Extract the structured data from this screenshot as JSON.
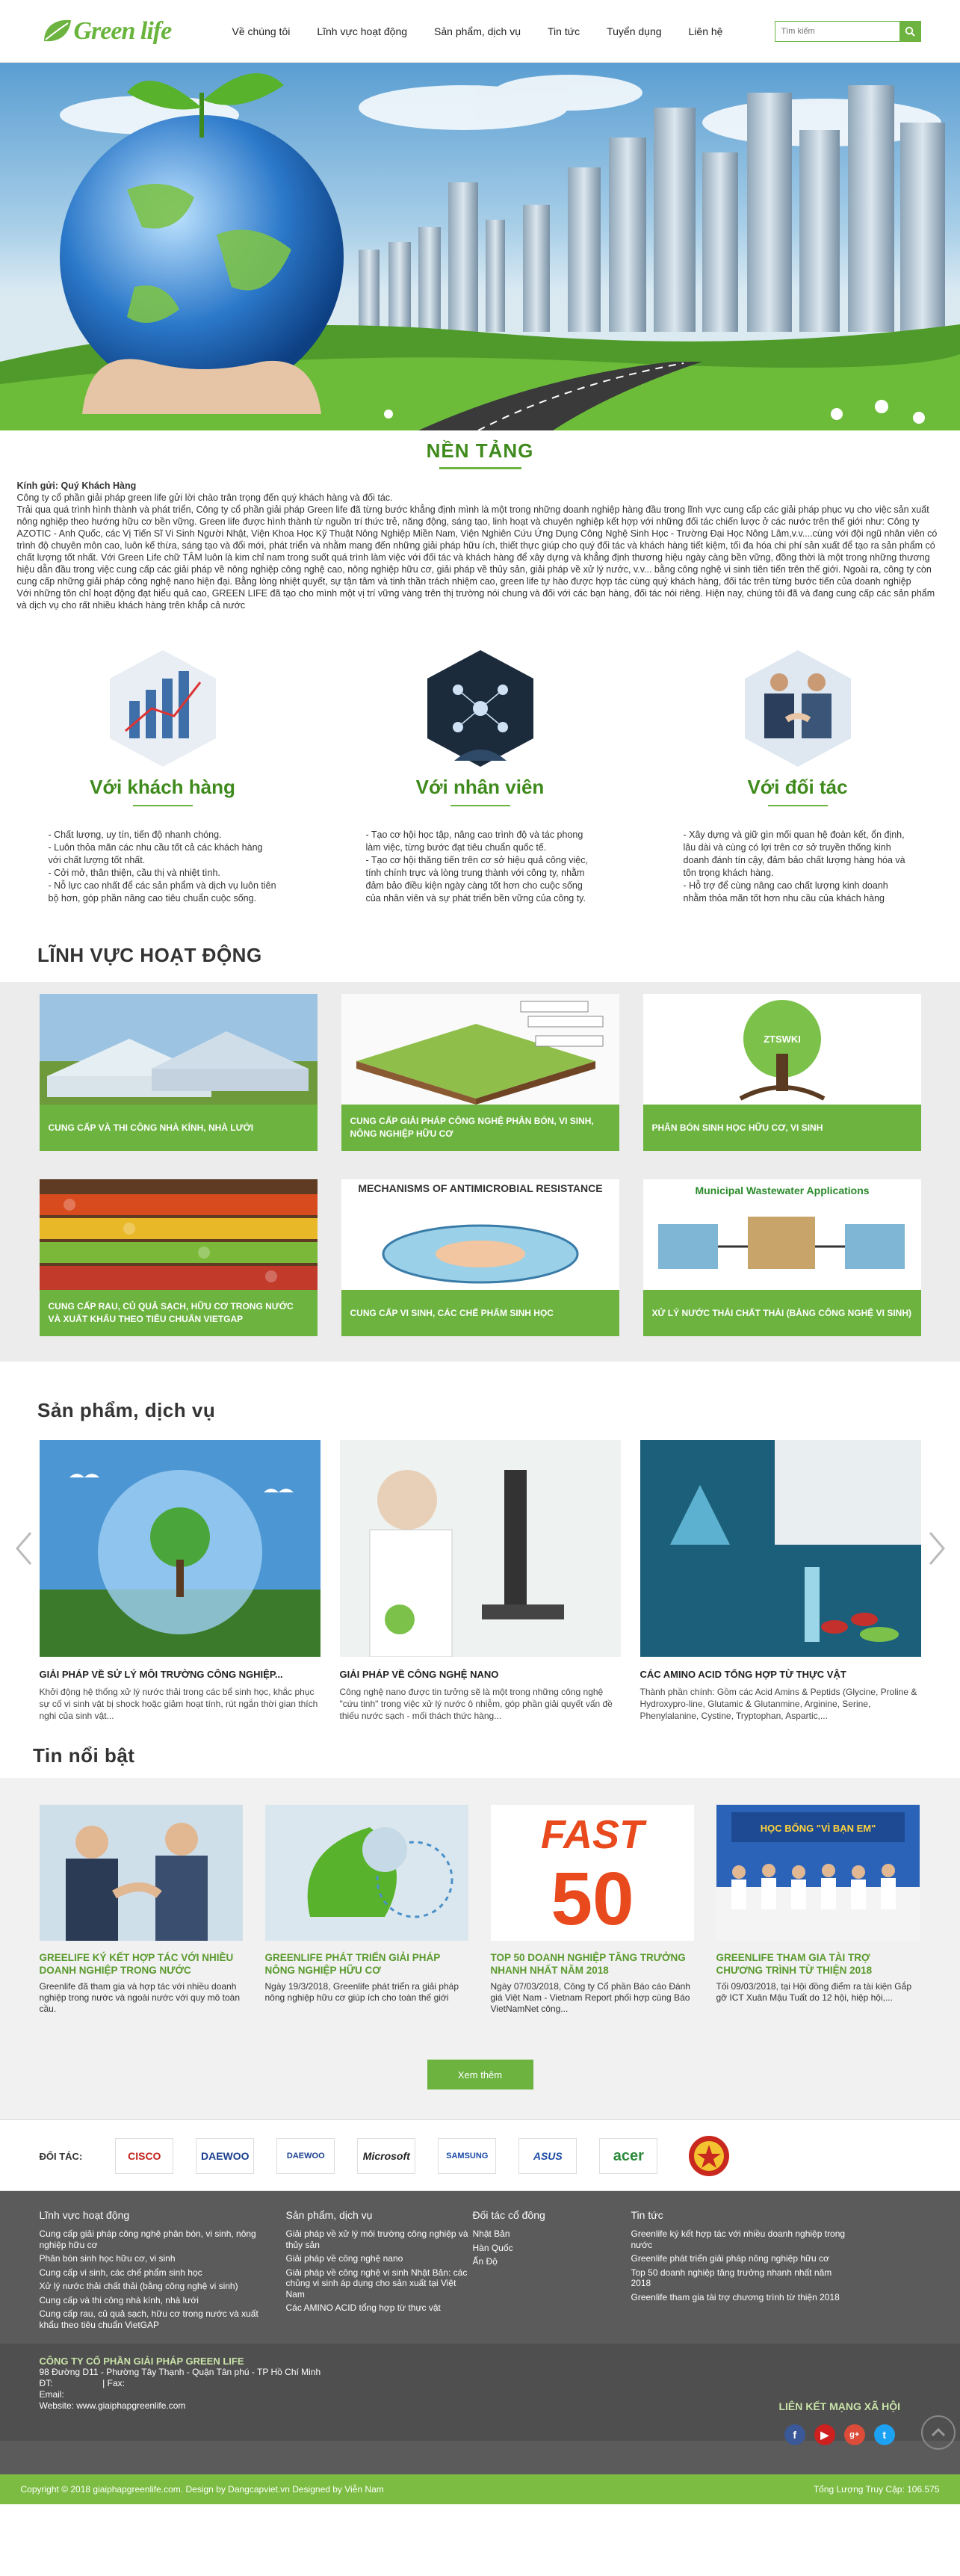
{
  "header": {
    "logo": "Green life",
    "nav": [
      "Về chúng tôi",
      "Lĩnh vực hoạt động",
      "Sản phẩm, dịch vụ",
      "Tin tức",
      "Tuyển dụng",
      "Liên hệ"
    ],
    "search_placeholder": "Tìm kiếm"
  },
  "nen_tang": {
    "title": "NỀN TẢNG",
    "greeting": "Kính gửi: Quý Khách Hàng",
    "p1": "Công ty cổ phần giải pháp green life gửi lời chào trân trọng đến quý khách hàng và đối tác.",
    "p2": "Trải qua quá trình hình thành và phát triển, Công ty cổ phần giải pháp Green life đã từng bước khẳng định mình là một trong những doanh nghiệp hàng đầu trong lĩnh vực cung cấp các giải pháp phục vụ cho việc sản xuất nông nghiệp theo hướng hữu cơ bền vững. Green life được hình thành từ nguồn trí thức trẻ, năng động, sáng tạo, linh hoạt và chuyên nghiệp kết hợp với những đối tác chiến lược ở các nước trên thế giới như: Công ty AZOTIC - Anh Quốc, các Vị Tiến Sĩ Vi Sinh Người Nhật, Viện Khoa Học Kỹ Thuật Nông Nghiệp Miền Nam, Viện Nghiên Cứu Ứng Dụng Công Nghệ Sinh Học - Trường Đại Học Nông Lâm,v.v....cùng với đội ngũ nhân viên có trình độ chuyên môn cao, luôn kế thừa, sáng tạo và đổi mới, phát triển và nhằm mang đến những giải pháp hữu ích, thiết thực giúp cho quý đối tác và khách hàng tiết kiệm, tối đa hóa chi phí sản xuất để tạo ra sản phẩm có chất lượng tốt nhất. Với Green Life chữ TÂM luôn là kim chỉ nam trong suốt quá trình làm việc với đối tác và khách hàng để xây dựng và khẳng định thương hiệu ngày càng bền vững, đồng thời là một trong những thương hiệu dẫn đầu trong việc cung cấp các giải pháp về nông nghiệp công nghệ cao, nông nghiệp hữu cơ, giải pháp về thủy sản, giải pháp về xử lý nước, v.v... bằng công nghệ vi sinh tiên tiến trên thế giới. Ngoài ra, công ty còn cung cấp những giải pháp công nghệ nano hiện đại. Bằng lòng nhiệt quyết, sự tận tâm và tinh thần trách nhiệm cao, green life tự hào được hợp tác cùng quý khách hàng, đối tác trên từng bước tiến của doanh nghiệp",
    "p3": "Với những tôn chỉ hoạt động đạt hiểu quả cao, GREEN LIFE đã tạo cho mình một vị trí vững vàng trên thị trường nói chung và đối với các bạn hàng, đối tác nói riêng. Hiện nay, chúng tôi đã và đang cung cấp các sản phẩm và dịch vụ cho rất nhiều khách hàng trên khắp cả nước"
  },
  "values": [
    {
      "title": "Với khách hàng",
      "lines": [
        "- Chất lượng, uy tín, tiến độ nhanh chóng.",
        "- Luôn thỏa mãn các nhu cầu tốt cả các khách hàng với chất lượng tốt nhất.",
        "- Cởi mở, thân thiện, cầu thị và nhiệt tình.",
        "- Nỗ lực cao nhất để các sản phẩm và dịch vụ luôn tiên bộ hơn, góp phần nâng cao tiêu chuẩn cuộc sống."
      ]
    },
    {
      "title": "Với nhân viên",
      "lines": [
        "- Tạo cơ hội học tập, nâng cao trình độ và tác phong làm việc, từng bước đạt tiêu chuẩn quốc tế.",
        "- Tạo cơ hội thăng tiến trên cơ sở hiệu quả công việc, tính chính trực và lòng trung thành với công ty, nhằm đảm bảo điều kiện ngày càng tốt hơn cho cuộc sống của nhân viên và sự phát triển bền vững của công ty."
      ]
    },
    {
      "title": "Với đối tác",
      "lines": [
        "- Xây dựng và giữ gìn mối quan hệ đoàn kết, ổn định, lâu dài và cùng có lợi trên cơ sở truyền thống kinh doanh đánh tín cậy, đảm bảo chất lượng hàng hóa và tôn trọng khách hàng.",
        "- Hỗ trợ để cùng nâng cao chất lượng kinh doanh nhằm thỏa mãn tốt hơn nhu cầu của khách hàng"
      ]
    }
  ],
  "linh_vuc": {
    "title": "LĨNH VỰC HOẠT ĐỘNG",
    "cards": [
      "CUNG CẤP VÀ THI CÔNG NHÀ KÍNH, NHÀ LƯỚI",
      "CUNG CẤP GIẢI PHÁP CÔNG NGHỆ PHÂN BÓN, VI SINH, NÔNG NGHIỆP HỮU CƠ",
      "PHÂN BÓN SINH HỌC HỮU CƠ, VI SINH",
      "CUNG CẤP RAU, CỦ QUẢ SẠCH, HỮU CƠ TRONG NƯỚC VÀ XUẤT KHẨU THEO TIÊU CHUẨN VIETGAP",
      "CUNG CẤP VI SINH, CÁC CHẾ PHẨM SINH HỌC",
      "XỬ LÝ NƯỚC THẢI CHẤT THẢI (BẰNG CÔNG NGHỆ VI SINH)"
    ],
    "img_texts": {
      "ztswki": "ZTSWKI",
      "mechanisms": "MECHANISMS OF ANTIMICROBIAL RESISTANCE",
      "wastewater": "Municipal Wastewater Applications"
    }
  },
  "san_pham": {
    "title": "Sản phẩm, dịch vụ",
    "items": [
      {
        "title": "GIẢI PHÁP VỀ SỬ LÝ MÔI TRƯỜNG CÔNG NGHIỆP...",
        "desc": "Khởi động hệ thống xử lý nước thải trong các bể sinh học, khắc phục sự cố vi sinh vật bị shock hoặc giảm hoạt tính, rút ngắn thời gian thích nghi của sinh vật..."
      },
      {
        "title": "GIẢI PHÁP VỀ CÔNG NGHỆ NANO",
        "desc": "Công nghệ nano được tin tưởng sẽ là một trong những công nghệ \"cứu tinh\" trong việc xử lý nước ô nhiễm, góp phần giải quyết vấn đề thiếu nước sạch - mối thách thức hàng..."
      },
      {
        "title": "CÁC AMINO ACID TỔNG HỢP TỪ THỰC VẬT",
        "desc": "Thành phần chính: Gồm các Acid Amins & Peptids (Glycine, Proline & Hydroxypro-line, Glutamic & Glutanmine, Arginine, Serine, Phenylalanine, Cystine, Tryptophan, Aspartic,..."
      }
    ]
  },
  "tin": {
    "title": "Tin nổi bật",
    "items": [
      {
        "title": "GREELIFE KÝ KẾT HỢP TÁC VỚI NHIỀU DOANH NGHIỆP TRONG NƯỚC",
        "desc": "Greenlife đã tham gia và hợp tác với nhiều doanh nghiệp trong nước và ngoài nước với quy mô toàn cầu."
      },
      {
        "title": "GREENLIFE PHÁT TRIỂN GIẢI PHÁP NÔNG NGHIỆP HỮU CƠ",
        "desc": "Ngày 19/3/2018, Greenlife phát triển ra giải pháp nông nghiệp hữu cơ giúp ích cho toàn thế giới"
      },
      {
        "title": "TOP 50 DOANH NGHIỆP TĂNG TRƯỞNG NHANH NHẤT NĂM 2018",
        "desc": "Ngày 07/03/2018, Công ty Cổ phần Báo cáo Đánh giá Việt Nam - Vietnam Report phối hợp cùng Báo VietNamNet công..."
      },
      {
        "title": "GREENLIFE THAM GIA TÀI TRỢ CHƯƠNG TRÌNH TỪ THIỆN 2018",
        "desc": "Tối 09/03/2018, tại Hội đồng điểm ra tài kiện Gắp gỡ ICT Xuân Mậu Tuất do 12 hội, hiệp hội,..."
      }
    ],
    "img_texts": {
      "fast": "FAST",
      "fifty": "50",
      "banner": "HỌC BỔNG \"VÌ BẠN EM\""
    },
    "more": "Xem thêm"
  },
  "partners": {
    "label": "ĐỐI TÁC:",
    "logos": [
      "CISCO",
      "DAEWOO",
      "DAEWOO",
      "Microsoft",
      "SAMSUNG",
      "ASUS",
      "acer",
      ""
    ]
  },
  "footer": {
    "cols": [
      {
        "title": "Lĩnh vực hoạt động",
        "items": [
          "Cung cấp giải pháp công nghệ phân bón, vi sinh, nông nghiệp hữu cơ",
          "Phân bón sinh học hữu cơ, vi sinh",
          "Cung cấp vi sinh, các chế phẩm sinh học",
          "Xử lý nước thải chất thải (bằng công nghệ vi sinh)",
          "Cung cấp và thi công nhà kính, nhà lưới",
          "Cung cấp rau, củ quả sạch, hữu cơ trong nước và xuất khẩu theo tiêu chuẩn VietGAP"
        ]
      },
      {
        "title": "Sản phẩm, dịch vụ",
        "items": [
          "Giải pháp về xử lý môi trường công nghiệp và thủy sản",
          "Giải pháp về công nghệ nano",
          "Giải pháp về công nghệ vi sinh Nhật Bản: các chủng vi sinh áp dụng cho sản xuất tại Việt Nam",
          "Các AMINO ACID tổng hợp từ thực vật"
        ]
      },
      {
        "title": "Đối tác cổ đông",
        "items": [
          "Nhật Bản",
          "Hàn Quốc",
          "Ấn Độ"
        ]
      },
      {
        "title": "Tin tức",
        "items": [
          "Greenlife ký kết hợp tác với nhiều doanh nghiệp trong nước",
          "Greenlife phát triển giải pháp nông nghiệp hữu cơ",
          "Top 50 doanh nghiệp tăng trưởng nhanh nhất năm 2018",
          "Greenlife tham gia tài trợ chương trình từ thiện 2018"
        ]
      }
    ],
    "company": "CÔNG TY CỔ PHẦN GIẢI PHÁP GREEN LIFE",
    "address": "98 Đường D11 - Phường Tây Thạnh - Quận Tân phú - TP Hồ Chí Minh",
    "phone": "ĐT:                    | Fax:",
    "email": "Email:",
    "website": "Website: www.giaiphapgreenlife.com",
    "social_title": "LIÊN KẾT MẠNG XÃ HỘI",
    "social": [
      "f",
      "▶",
      "g+",
      "t"
    ],
    "copyright": "Copyright © 2018 giaiphapgreenlife.com. Design by Dangcapviet.vn Designed by Viễn Nam",
    "counter": "Tổng Lượng Truy Cập: 106.575"
  }
}
